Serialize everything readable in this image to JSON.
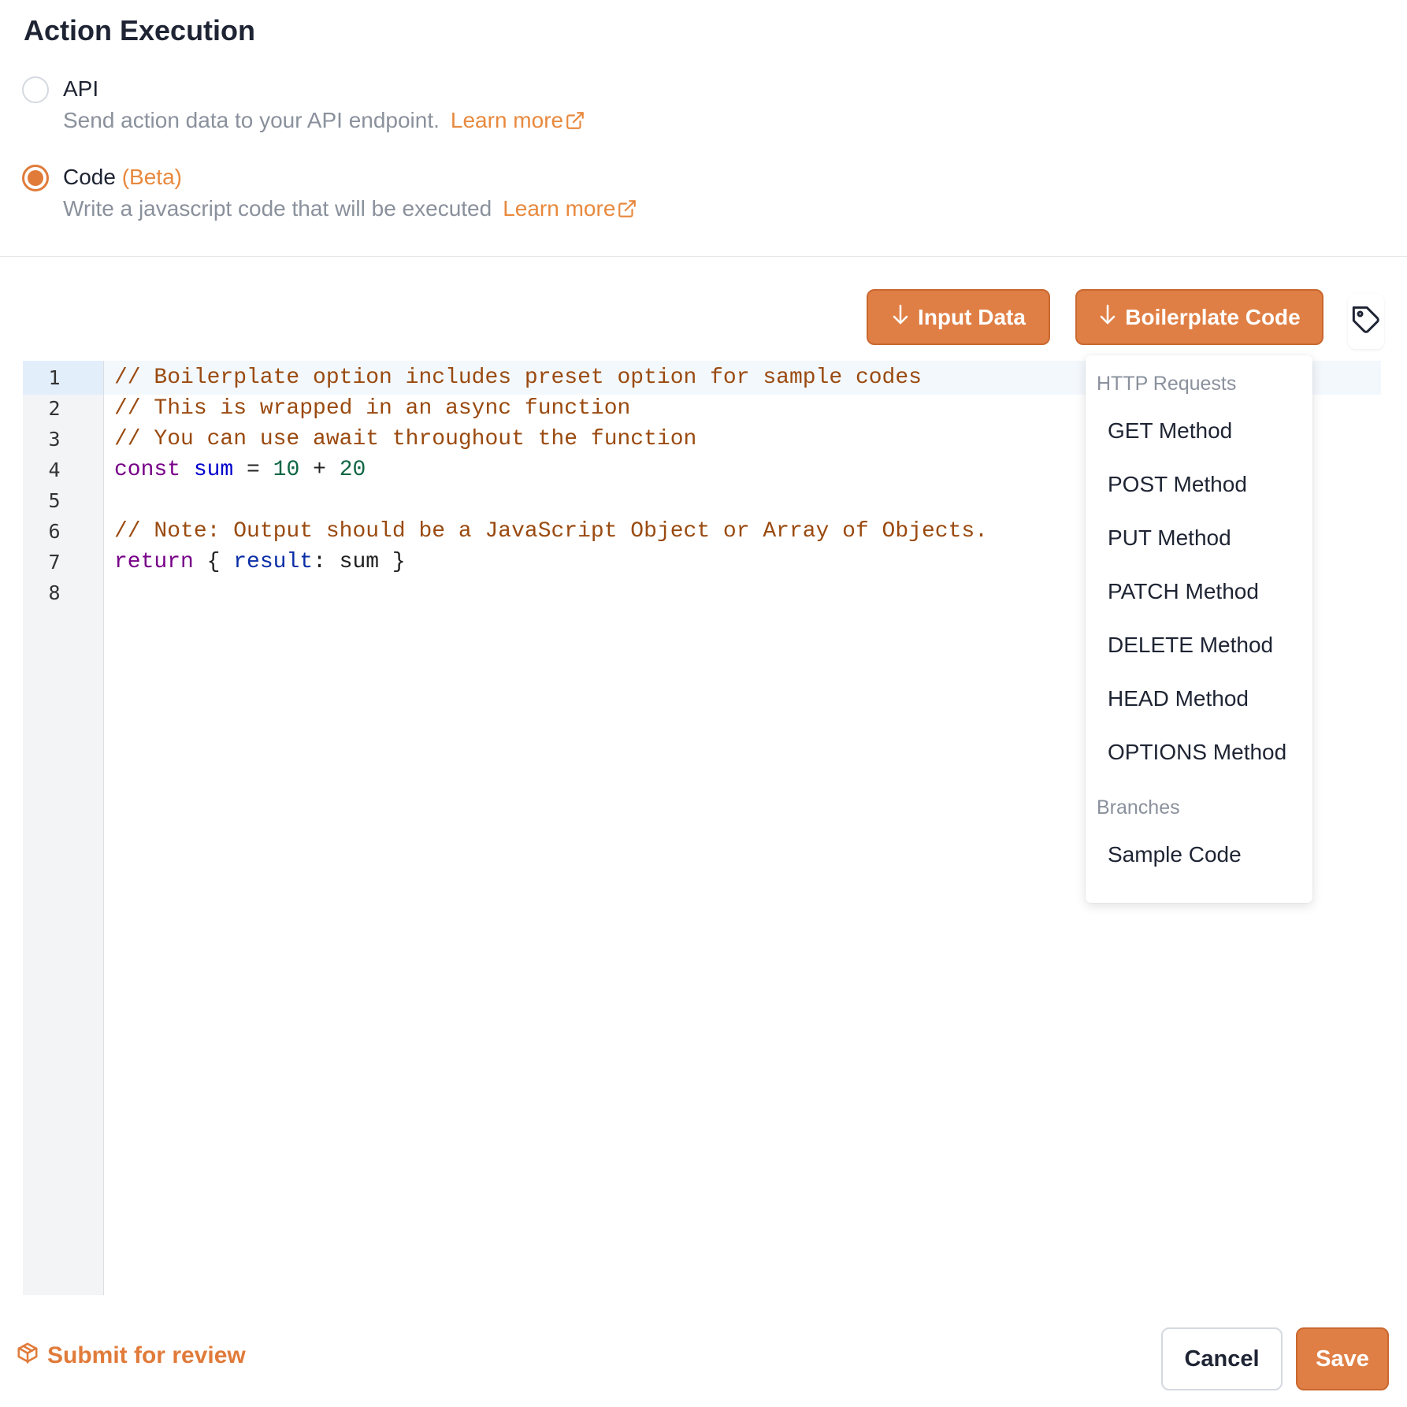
{
  "section": {
    "title": "Action Execution",
    "options": [
      {
        "label": "API",
        "badge": "",
        "description": "Send action data to your API endpoint.",
        "link": "Learn more",
        "selected": false
      },
      {
        "label": "Code",
        "badge": "(Beta)",
        "description": "Write a javascript code that will be executed",
        "link": "Learn more",
        "selected": true
      }
    ]
  },
  "toolbar": {
    "input_data_label": "Input Data",
    "boilerplate_label": "Boilerplate Code",
    "tag_icon": "tag-icon",
    "arrow_icon": "arrow-down-icon"
  },
  "editor": {
    "line_numbers": [
      "1",
      "2",
      "3",
      "4",
      "5",
      "6",
      "7",
      "8"
    ],
    "lines": [
      [
        {
          "t": "// Boilerplate option includes preset option for sample codes",
          "c": "comment"
        }
      ],
      [
        {
          "t": "// This is wrapped in an async function",
          "c": "comment"
        }
      ],
      [
        {
          "t": "// You can use await throughout the function",
          "c": "comment"
        }
      ],
      [
        {
          "t": "const",
          "c": "keyword"
        },
        {
          "t": " ",
          "c": "plain"
        },
        {
          "t": "sum",
          "c": "def"
        },
        {
          "t": " = ",
          "c": "plain"
        },
        {
          "t": "10",
          "c": "num"
        },
        {
          "t": " + ",
          "c": "plain"
        },
        {
          "t": "20",
          "c": "num"
        }
      ],
      [],
      [
        {
          "t": "// Note: Output should be a JavaScript Object or Array of Objects.",
          "c": "comment"
        }
      ],
      [
        {
          "t": "return",
          "c": "keyword"
        },
        {
          "t": " { ",
          "c": "plain"
        },
        {
          "t": "result",
          "c": "prop"
        },
        {
          "t": ": sum }",
          "c": "plain"
        }
      ],
      []
    ],
    "active_line": 1
  },
  "menu": {
    "groups": [
      {
        "title": "HTTP Requests",
        "items": [
          "GET Method",
          "POST Method",
          "PUT Method",
          "PATCH Method",
          "DELETE Method",
          "HEAD Method",
          "OPTIONS Method"
        ]
      },
      {
        "title": "Branches",
        "items": [
          "Sample Code"
        ]
      }
    ]
  },
  "footer": {
    "submit_label": "Submit for review",
    "submit_icon": "package-icon",
    "cancel_label": "Cancel",
    "save_label": "Save"
  },
  "colors": {
    "accent": "#e07f45",
    "accent_text": "#e8893e"
  }
}
